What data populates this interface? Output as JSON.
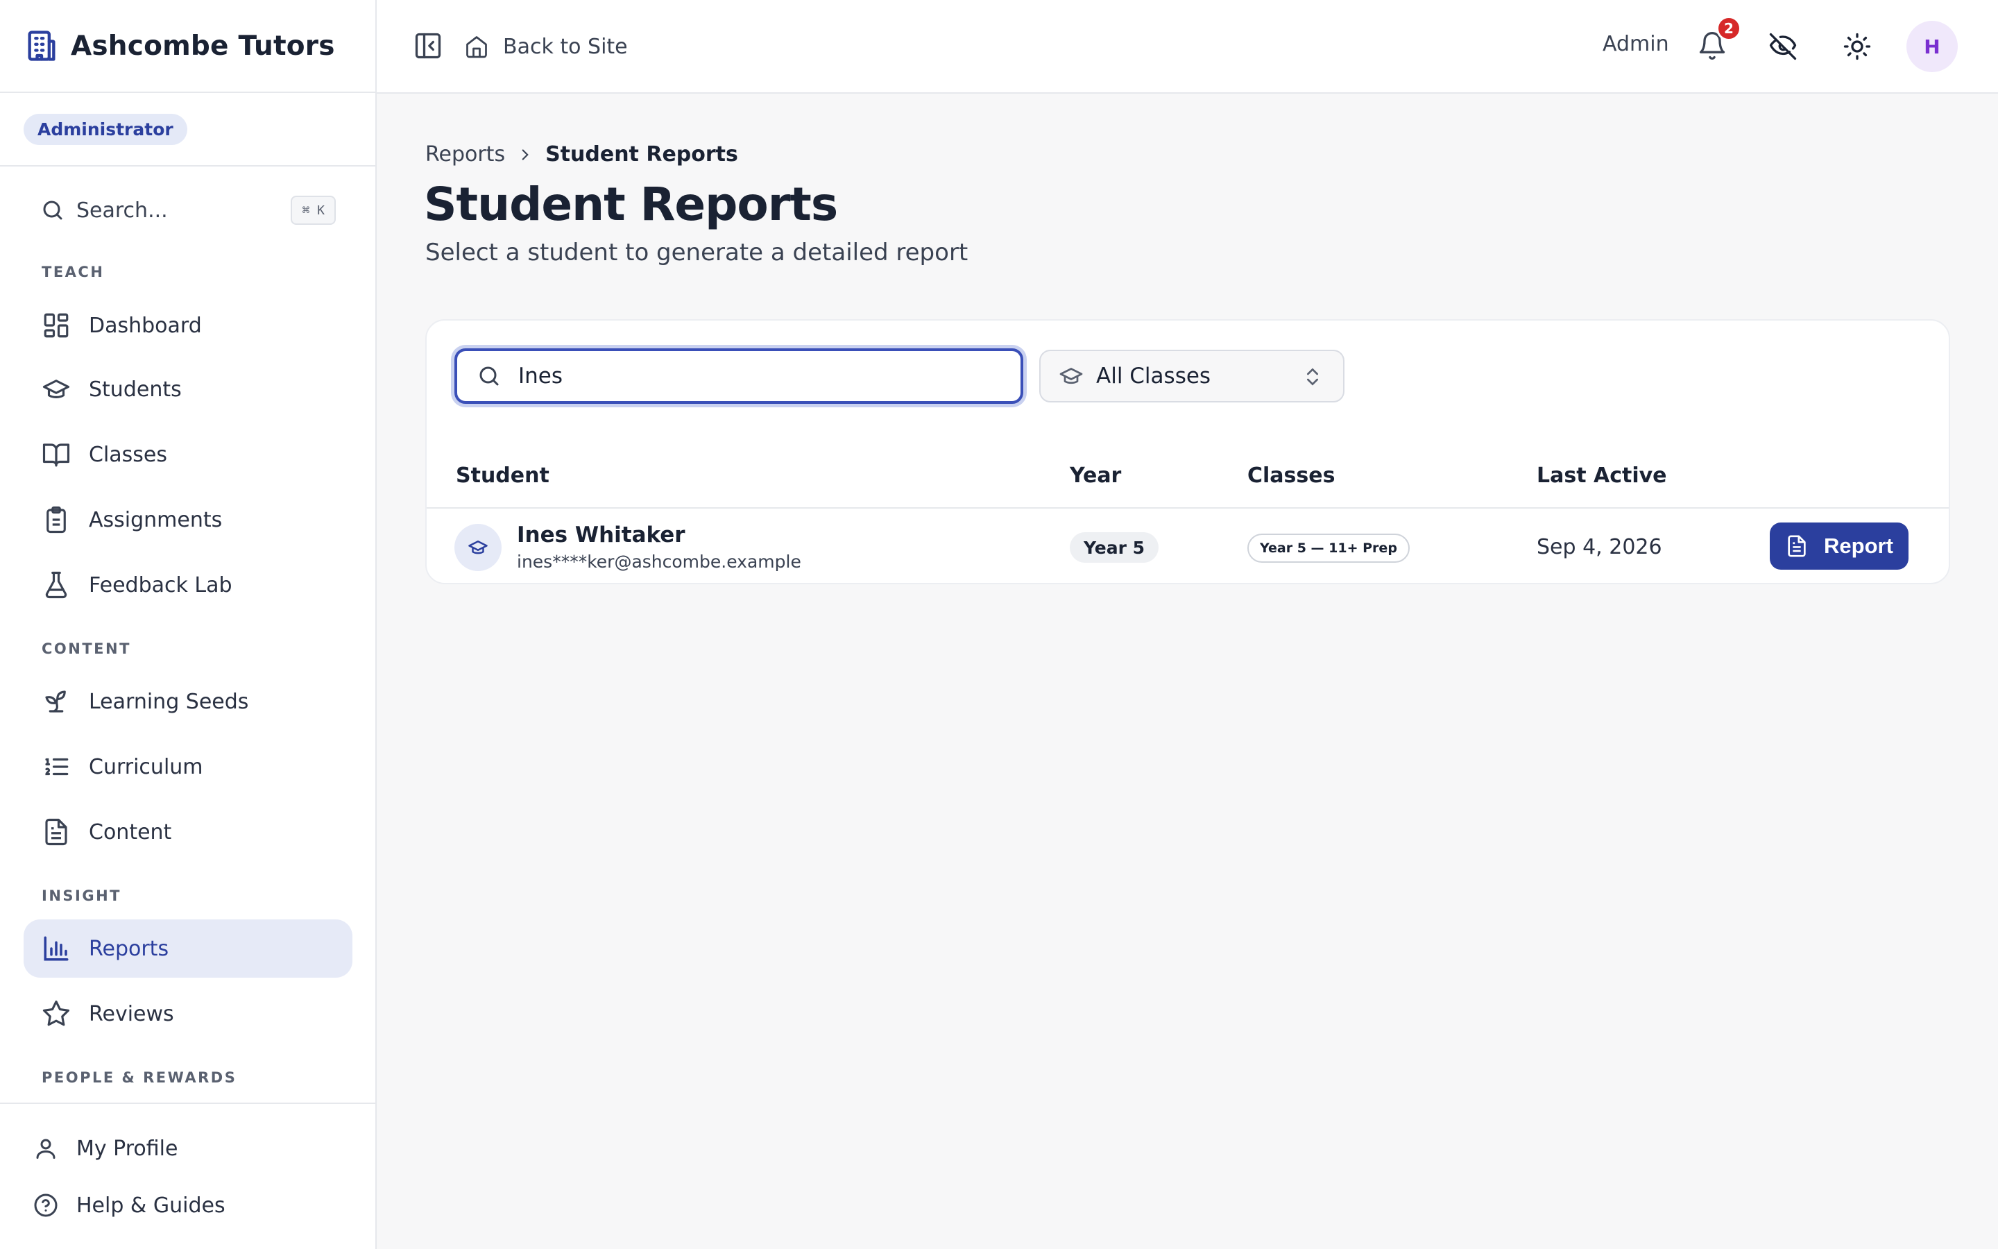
{
  "app": {
    "brand_name": "Ashcombe Tutors",
    "brand_icon": "building-icon",
    "role_badge": "Administrator"
  },
  "sidebar": {
    "search_placeholder": "Search...",
    "search_shortcut": "⌘ K",
    "sections": [
      {
        "label": "TEACH"
      },
      {
        "label": "CONTENT"
      },
      {
        "label": "INSIGHT"
      },
      {
        "label": "PEOPLE & REWARDS"
      }
    ],
    "items": [
      {
        "label": "Dashboard",
        "icon": "dashboard-icon"
      },
      {
        "label": "Students",
        "icon": "graduation-cap-icon"
      },
      {
        "label": "Classes",
        "icon": "book-open-icon"
      },
      {
        "label": "Assignments",
        "icon": "clipboard-icon"
      },
      {
        "label": "Feedback Lab",
        "icon": "flask-icon"
      },
      {
        "label": "Learning Seeds",
        "icon": "sprout-icon"
      },
      {
        "label": "Curriculum",
        "icon": "list-ordered-icon"
      },
      {
        "label": "Content",
        "icon": "file-text-icon"
      },
      {
        "label": "Reports",
        "icon": "bar-chart-icon",
        "active": true
      },
      {
        "label": "Reviews",
        "icon": "star-icon"
      }
    ],
    "footer": [
      {
        "label": "My Profile",
        "icon": "user-icon"
      },
      {
        "label": "Help & Guides",
        "icon": "help-circle-icon"
      }
    ]
  },
  "topbar": {
    "back_label": "Back to Site",
    "user_label": "Admin",
    "notification_count": "2",
    "avatar_initial": "H"
  },
  "breadcrumb": {
    "parent": "Reports",
    "current": "Student Reports"
  },
  "page": {
    "title": "Student Reports",
    "subtitle": "Select a student to generate a detailed report"
  },
  "filters": {
    "search_value": "Ines",
    "class_filter": "All Classes"
  },
  "table": {
    "columns": [
      "Student",
      "Year",
      "Classes",
      "Last Active"
    ],
    "rows": [
      {
        "name": "Ines Whitaker",
        "email": "ines****ker@ashcombe.example",
        "year": "Year 5",
        "classes": "Year 5 — 11+ Prep",
        "last_active": "Sep 4, 2026",
        "action_label": "Report"
      }
    ]
  },
  "colors": {
    "accent": "#2b3f9e",
    "active_nav_bg": "#e6eaf7",
    "badge_red": "#d62828",
    "avatar_purple": "#7a2fd0"
  }
}
